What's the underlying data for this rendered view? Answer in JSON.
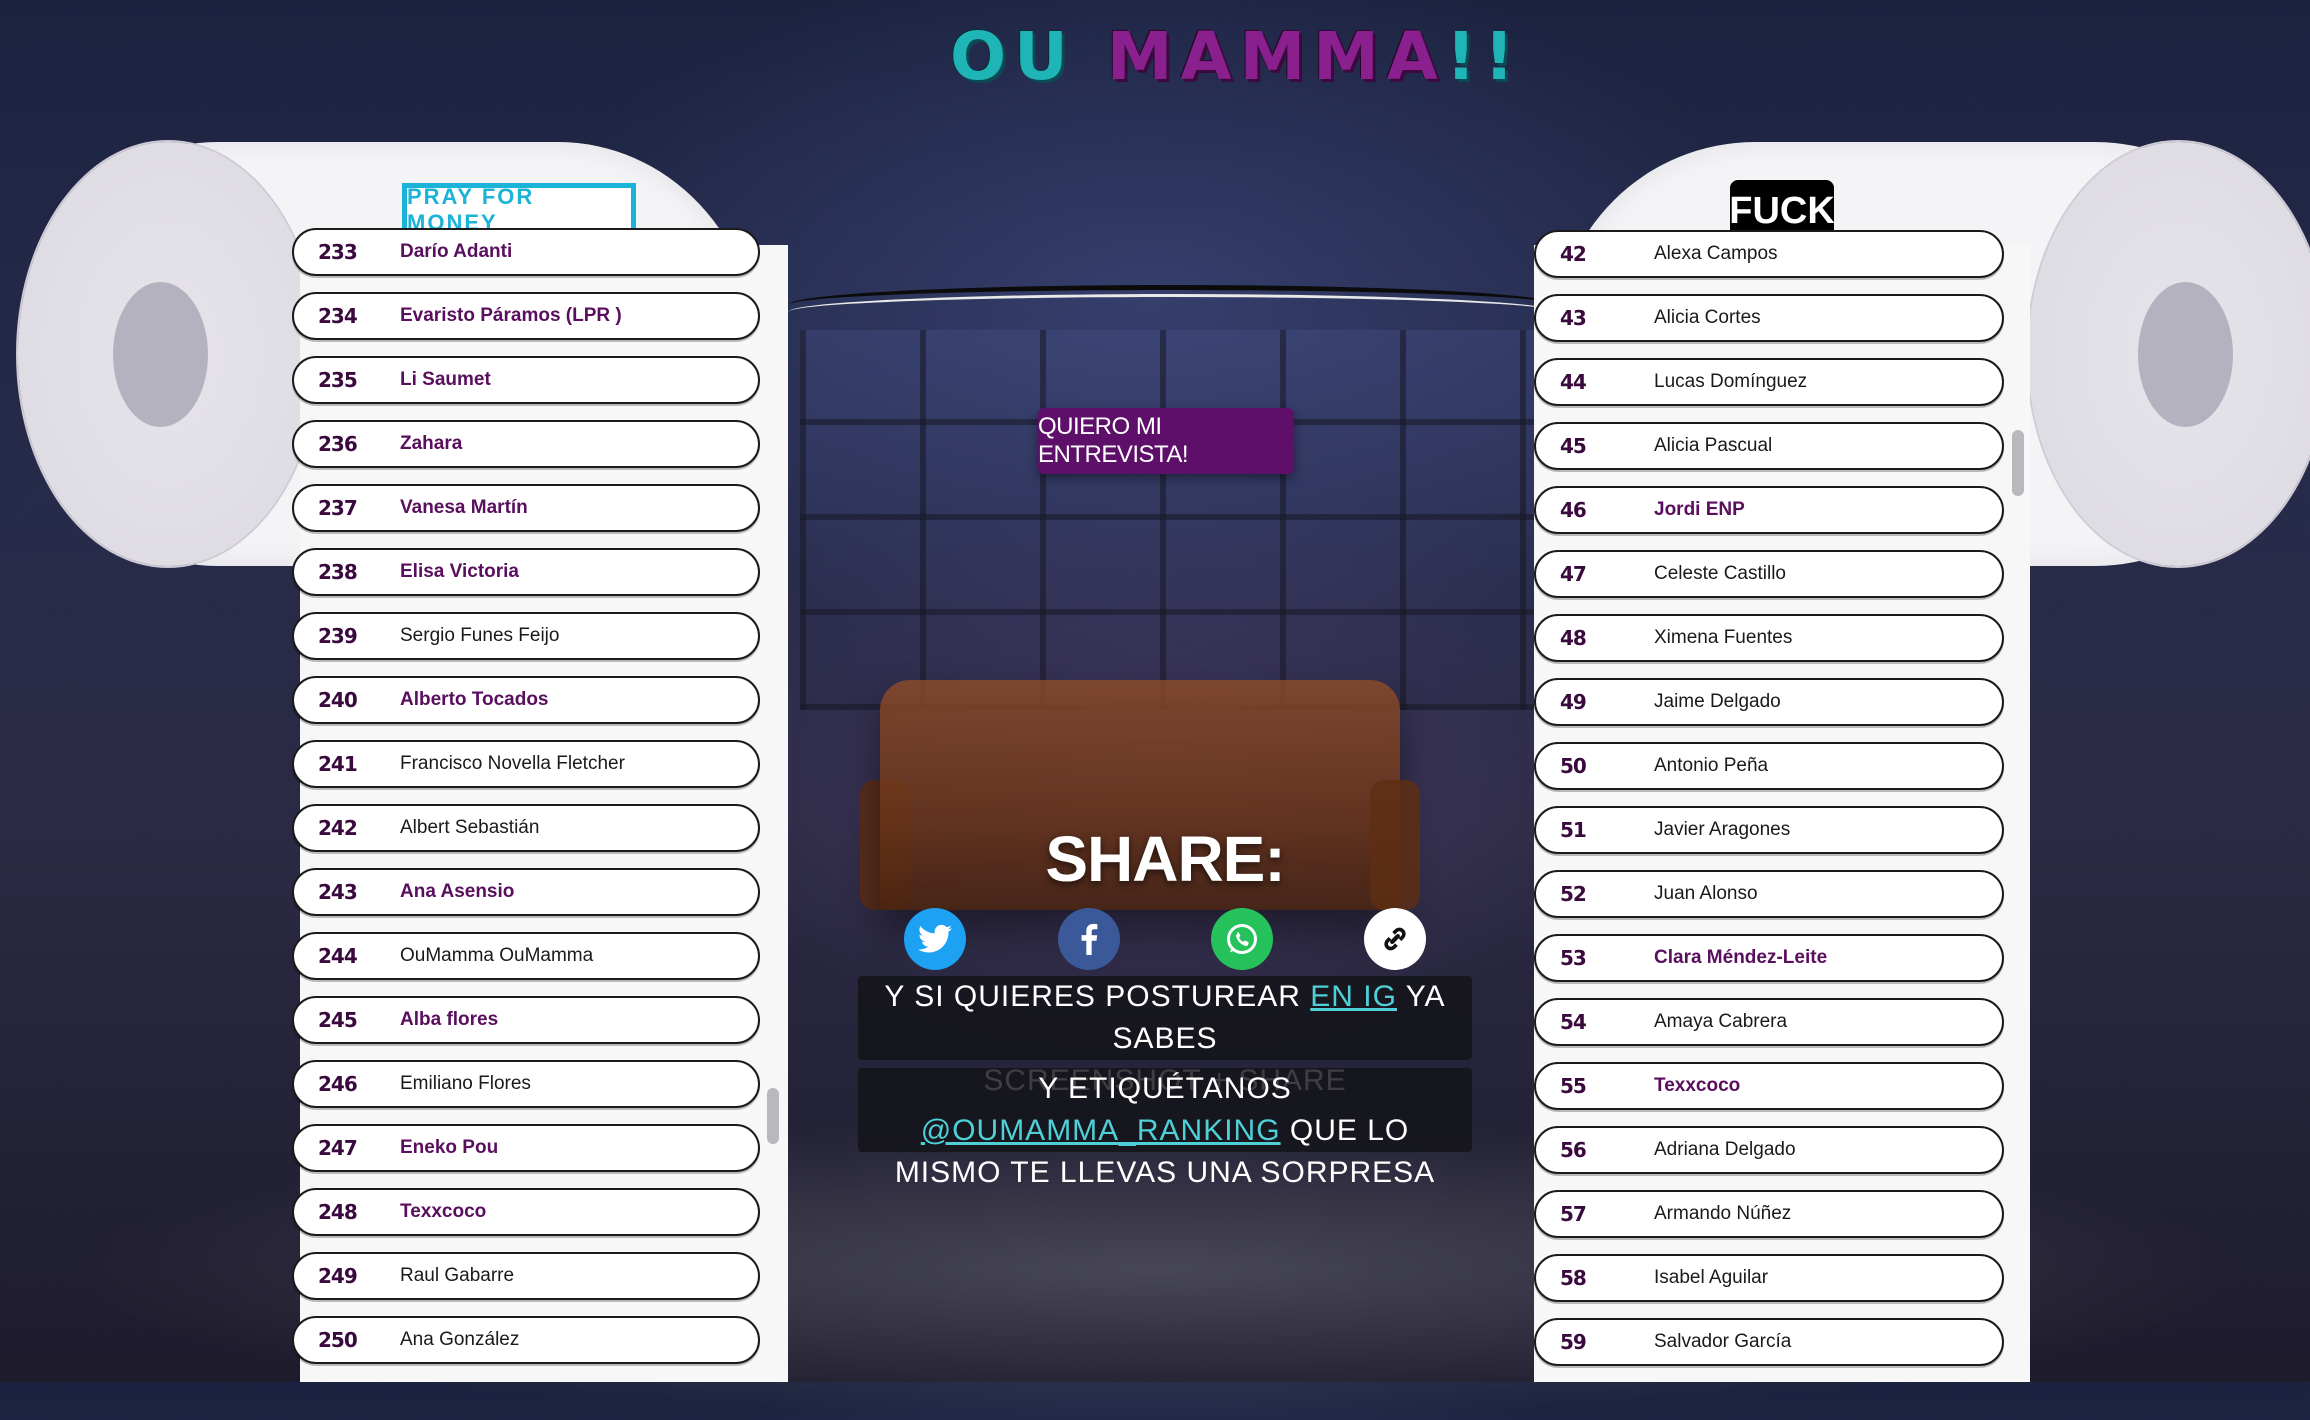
{
  "app": {
    "logo_ou": "OU",
    "logo_mamma": "MAMMA",
    "logo_excl": "!!"
  },
  "left_panel": {
    "badge": "PRAY FOR MONEY",
    "items": [
      {
        "rank": "233",
        "name": "Darío Adanti",
        "highlight": true
      },
      {
        "rank": "234",
        "name": "Evaristo Páramos (LPR )",
        "highlight": true
      },
      {
        "rank": "235",
        "name": "Li Saumet",
        "highlight": true
      },
      {
        "rank": "236",
        "name": "Zahara",
        "highlight": true
      },
      {
        "rank": "237",
        "name": "Vanesa Martín",
        "highlight": true
      },
      {
        "rank": "238",
        "name": "Elisa Victoria",
        "highlight": true
      },
      {
        "rank": "239",
        "name": "Sergio Funes Feijo",
        "highlight": false
      },
      {
        "rank": "240",
        "name": "Alberto Tocados",
        "highlight": true
      },
      {
        "rank": "241",
        "name": "Francisco Novella Fletcher",
        "highlight": false
      },
      {
        "rank": "242",
        "name": "Albert Sebastián",
        "highlight": false
      },
      {
        "rank": "243",
        "name": "Ana Asensio",
        "highlight": true
      },
      {
        "rank": "244",
        "name": "OuMamma OuMamma",
        "highlight": false
      },
      {
        "rank": "245",
        "name": "Alba flores",
        "highlight": true
      },
      {
        "rank": "246",
        "name": "Emiliano Flores",
        "highlight": false
      },
      {
        "rank": "247",
        "name": "Eneko Pou",
        "highlight": true
      },
      {
        "rank": "248",
        "name": "Texxcoco",
        "highlight": true
      },
      {
        "rank": "249",
        "name": "Raul Gabarre",
        "highlight": false
      },
      {
        "rank": "250",
        "name": "Ana González",
        "highlight": false
      }
    ]
  },
  "right_panel": {
    "badge": "FUCK",
    "items": [
      {
        "rank": "42",
        "name": "Alexa Campos",
        "highlight": false
      },
      {
        "rank": "43",
        "name": "Alicia Cortes",
        "highlight": false
      },
      {
        "rank": "44",
        "name": "Lucas Domínguez",
        "highlight": false
      },
      {
        "rank": "45",
        "name": "Alicia Pascual",
        "highlight": false
      },
      {
        "rank": "46",
        "name": "Jordi ENP",
        "highlight": true
      },
      {
        "rank": "47",
        "name": "Celeste Castillo",
        "highlight": false
      },
      {
        "rank": "48",
        "name": "Ximena Fuentes",
        "highlight": false
      },
      {
        "rank": "49",
        "name": "Jaime Delgado",
        "highlight": false
      },
      {
        "rank": "50",
        "name": "Antonio Peña",
        "highlight": false
      },
      {
        "rank": "51",
        "name": "Javier Aragones",
        "highlight": false
      },
      {
        "rank": "52",
        "name": "Juan Alonso",
        "highlight": false
      },
      {
        "rank": "53",
        "name": "Clara Méndez-Leite",
        "highlight": true
      },
      {
        "rank": "54",
        "name": "Amaya Cabrera",
        "highlight": false
      },
      {
        "rank": "55",
        "name": "Texxcoco",
        "highlight": true
      },
      {
        "rank": "56",
        "name": "Adriana Delgado",
        "highlight": false
      },
      {
        "rank": "57",
        "name": "Armando Núñez",
        "highlight": false
      },
      {
        "rank": "58",
        "name": "Isabel Aguilar",
        "highlight": false
      },
      {
        "rank": "59",
        "name": "Salvador García",
        "highlight": false
      }
    ]
  },
  "center": {
    "cta_label": "QUIERO MI ENTREVISTA!",
    "share_title": "SHARE:",
    "share_icons": [
      "twitter-icon",
      "facebook-icon",
      "whatsapp-icon",
      "link-icon"
    ],
    "info1_a": "Y SI QUIERES POSTUREAR ",
    "info1_link": "EN IG",
    "info1_b": " YA SABES",
    "info1_c": "SCREENSHOT + SHARE",
    "info2_a": "Y ETIQUÉTANOS ",
    "info2_link": "@OUMAMMA_RANKING",
    "info2_b": " QUE LO",
    "info2_c": "MISMO TE LLEVAS UNA SORPRESA"
  },
  "colors": {
    "accent_purple": "#5e0f6a",
    "badge_cyan": "#1bb3d8",
    "twitter": "#1da1f2",
    "facebook": "#3b5998",
    "whatsapp": "#25c15a",
    "link_teal": "#4fd0d6"
  }
}
